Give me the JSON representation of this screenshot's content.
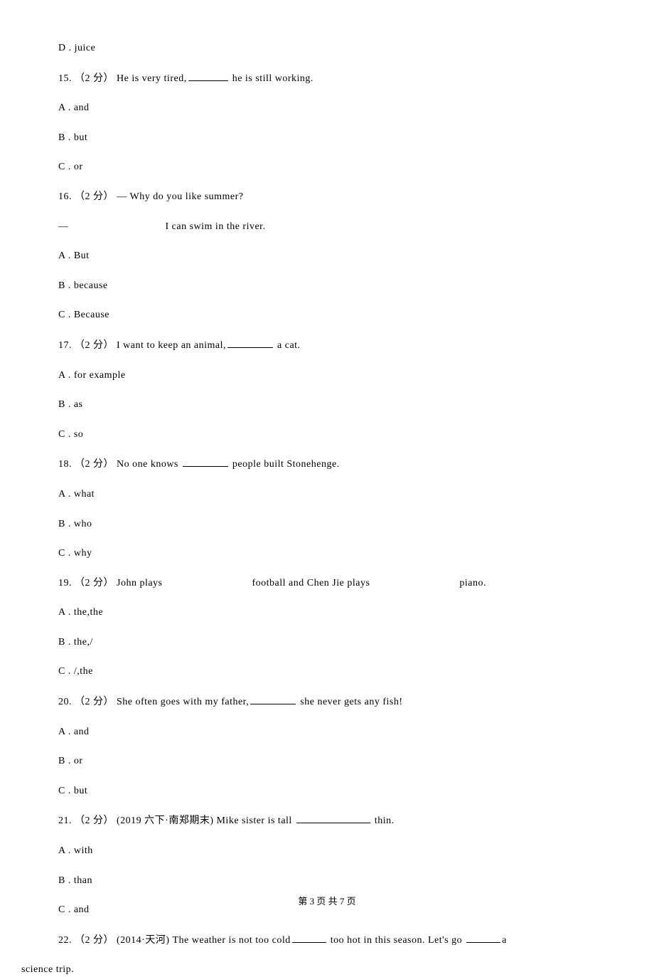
{
  "q14_d": "D . juice",
  "q15": {
    "stem_pre": "15. （2 分） He is very tired,",
    "stem_post": " he is still working.",
    "a": "A . and",
    "b": "B . but",
    "c": "C . or"
  },
  "q16": {
    "stem": "16. （2 分） ― Why do you like summer?",
    "line2_pre": "―",
    "line2_post": "I can swim in the river.",
    "a": "A . But",
    "b": "B . because",
    "c": "C . Because"
  },
  "q17": {
    "stem_pre": "17. （2 分） I want to keep an animal,",
    "stem_post": " a cat.",
    "a": "A . for example",
    "b": "B . as",
    "c": "C . so"
  },
  "q18": {
    "stem_pre": "18. （2 分） No one knows ",
    "stem_post": " people built Stonehenge.",
    "a": "A . what",
    "b": "B . who",
    "c": "C . why"
  },
  "q19": {
    "stem_pre": "19. （2 分） John plays",
    "stem_mid": "football and Chen Jie plays",
    "stem_post": "piano.",
    "a": "A . the,the",
    "b": "B . the,/",
    "c": "C . /,the"
  },
  "q20": {
    "stem_pre": "20. （2 分） She often goes with my father,",
    "stem_post": " she never gets any fish!",
    "a": "A . and",
    "b": "B . or",
    "c": "C . but"
  },
  "q21": {
    "stem_pre": "21. （2 分） (2019 六下·南郑期末) Mike sister is tall ",
    "stem_post": " thin.",
    "a": "A . with",
    "b": "B . than",
    "c": "C . and"
  },
  "q22": {
    "stem_pre": "22. （2 分） (2014·天河) The weather is not too cold",
    "stem_mid": " too hot in this season. Let's go ",
    "stem_post": "a",
    "line2": "science trip."
  },
  "footer": "第 3 页 共 7 页"
}
